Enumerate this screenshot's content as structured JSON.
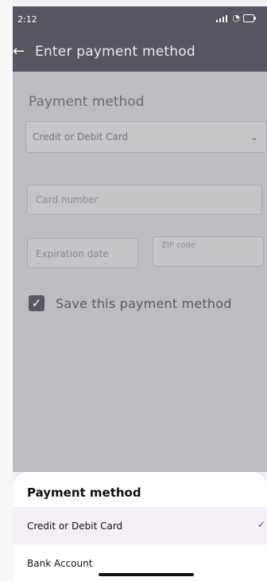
{
  "status": {
    "time": "2:12"
  },
  "nav": {
    "title": "Enter payment method"
  },
  "form": {
    "section_title": "Payment method",
    "selected_method": "Credit or Debit Card",
    "card_number_placeholder": "Card number",
    "expiration_placeholder": "Expiration date",
    "zip_placeholder": "ZIP code",
    "save_label": "Save this payment method"
  },
  "sheet": {
    "title": "Payment method",
    "options": [
      {
        "label": "Credit or Debit Card",
        "selected": true
      },
      {
        "label": "Bank Account",
        "selected": false
      }
    ]
  },
  "icons": {
    "back": "arrow-left-icon",
    "chevron": "chevron-down-icon",
    "checkbox": "check-icon",
    "selected": "check-icon",
    "signal": "signal-icon",
    "wifi": "wifi-icon",
    "battery": "battery-icon"
  },
  "colors": {
    "header": "#585563",
    "overlay": "#bdbcc0",
    "accent": "#7b3fa1",
    "selected_row": "#f4eff7"
  }
}
